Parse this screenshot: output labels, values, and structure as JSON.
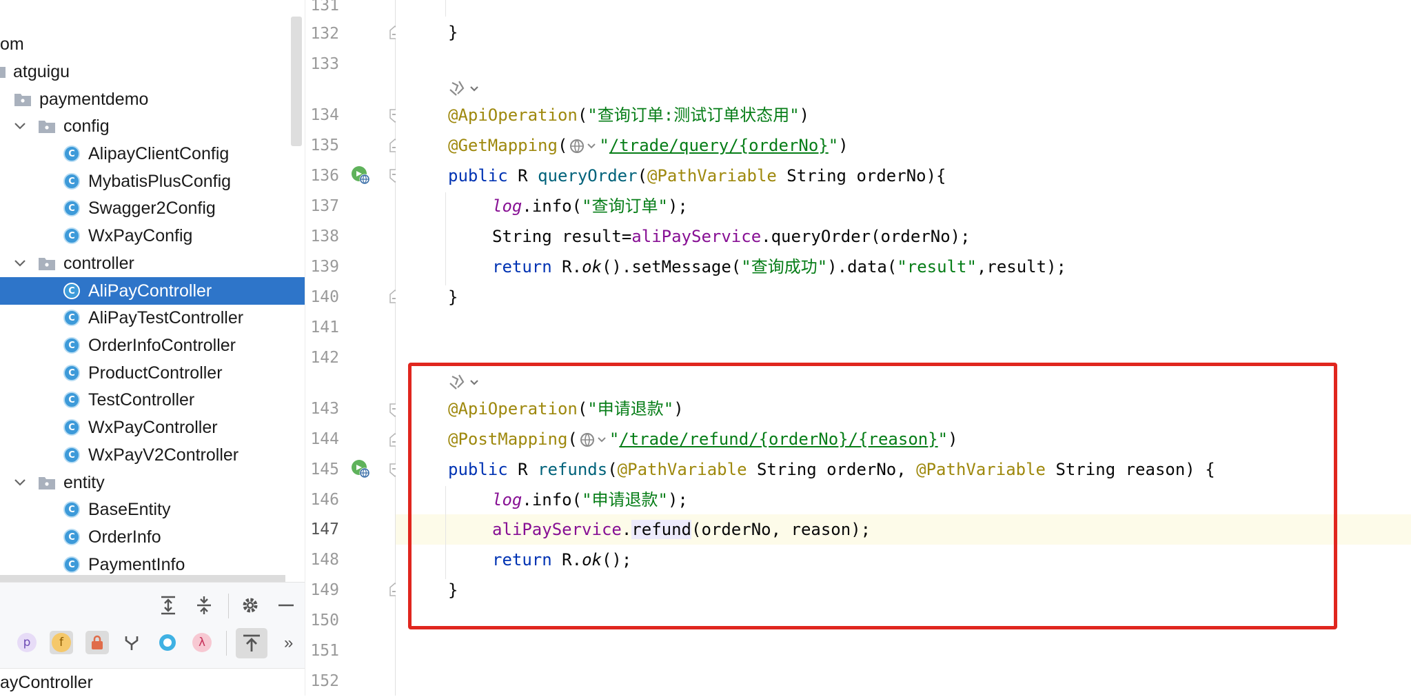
{
  "project_tree": {
    "items": [
      {
        "label": "om",
        "type": "package",
        "level": 0
      },
      {
        "label": "atguigu",
        "type": "package",
        "level": 0
      },
      {
        "label": "paymentdemo",
        "type": "folder",
        "level": 1
      },
      {
        "label": "config",
        "type": "folder",
        "level": 2,
        "expanded": true
      },
      {
        "label": "AlipayClientConfig",
        "type": "class",
        "level": 3
      },
      {
        "label": "MybatisPlusConfig",
        "type": "class",
        "level": 3
      },
      {
        "label": "Swagger2Config",
        "type": "class",
        "level": 3
      },
      {
        "label": "WxPayConfig",
        "type": "class",
        "level": 3
      },
      {
        "label": "controller",
        "type": "folder",
        "level": 2,
        "expanded": true
      },
      {
        "label": "AliPayController",
        "type": "class",
        "level": 3,
        "selected": true
      },
      {
        "label": "AliPayTestController",
        "type": "class",
        "level": 3
      },
      {
        "label": "OrderInfoController",
        "type": "class",
        "level": 3
      },
      {
        "label": "ProductController",
        "type": "class",
        "level": 3
      },
      {
        "label": "TestController",
        "type": "class",
        "level": 3
      },
      {
        "label": "WxPayController",
        "type": "class",
        "level": 3
      },
      {
        "label": "WxPayV2Controller",
        "type": "class",
        "level": 3
      },
      {
        "label": "entity",
        "type": "folder",
        "level": 2,
        "expanded": true
      },
      {
        "label": "BaseEntity",
        "type": "class",
        "level": 3
      },
      {
        "label": "OrderInfo",
        "type": "class",
        "level": 3
      },
      {
        "label": "PaymentInfo",
        "type": "class",
        "level": 3
      }
    ],
    "class_badge": "C"
  },
  "structure_panel": {
    "title": "ayController",
    "filter_badges": {
      "property": "p",
      "field": "f",
      "lambda": "λ"
    },
    "more": "»"
  },
  "gutter": {
    "line_numbers": [
      "131",
      "132",
      "133",
      "134",
      "135",
      "136",
      "137",
      "138",
      "139",
      "140",
      "141",
      "142",
      "143",
      "144",
      "145",
      "146",
      "147",
      "148",
      "149",
      "150",
      "151",
      "152"
    ],
    "current_line": "147"
  },
  "code": {
    "l132": "}",
    "l134_anno": "@ApiOperation",
    "l134_open": "(",
    "l134_str": "\"查询订单:测试订单状态用\"",
    "l134_close": ")",
    "l135_anno": "@GetMapping",
    "l135_open": "(",
    "l135_q1": "\"",
    "l135_url": "/trade/query/{orderNo}",
    "l135_q2": "\"",
    "l135_close": ")",
    "l136_kw": "public",
    "l136_type": " R ",
    "l136_fn": "queryOrder",
    "l136_open": "(",
    "l136_anno": "@PathVariable",
    "l136_rest": " String orderNo){",
    "l137_log": "log",
    "l137_dot": ".info(",
    "l137_str": "\"查询订单\"",
    "l137_end": ");",
    "l138_pre": "String result=",
    "l138_fld": "aliPayService",
    "l138_rest": ".queryOrder(orderNo);",
    "l139_kw": "return",
    "l139_a": " R.",
    "l139_ok": "ok",
    "l139_b": "().setMessage(",
    "l139_str1": "\"查询成功\"",
    "l139_c": ").data(",
    "l139_str2": "\"result\"",
    "l139_d": ",result);",
    "l140": "}",
    "l143_anno": "@ApiOperation",
    "l143_open": "(",
    "l143_str": "\"申请退款\"",
    "l143_close": ")",
    "l144_anno": "@PostMapping",
    "l144_open": "(",
    "l144_q1": "\"",
    "l144_url": "/trade/refund/{orderNo}/{reason}",
    "l144_q2": "\"",
    "l144_close": ")",
    "l145_kw": "public",
    "l145_type": " R ",
    "l145_fn": "refunds",
    "l145_open": "(",
    "l145_anno1": "@PathVariable",
    "l145_mid": " String orderNo, ",
    "l145_anno2": "@PathVariable",
    "l145_rest": " String reason) {",
    "l146_log": "log",
    "l146_dot": ".info(",
    "l146_str": "\"申请退款\"",
    "l146_end": ");",
    "l147_fld": "aliPayService",
    "l147_dot": ".",
    "l147_fn": "refund",
    "l147_rest": "(orderNo, reason);",
    "l148_kw": "return",
    "l148_a": " R.",
    "l148_ok": "ok",
    "l148_b": "();",
    "l149": "}"
  },
  "colors": {
    "selection": "#2e75c9",
    "highlight_box": "#e0261e",
    "keyword": "#0033b3",
    "annotation": "#9e880d",
    "string": "#067d17",
    "field": "#871094"
  }
}
